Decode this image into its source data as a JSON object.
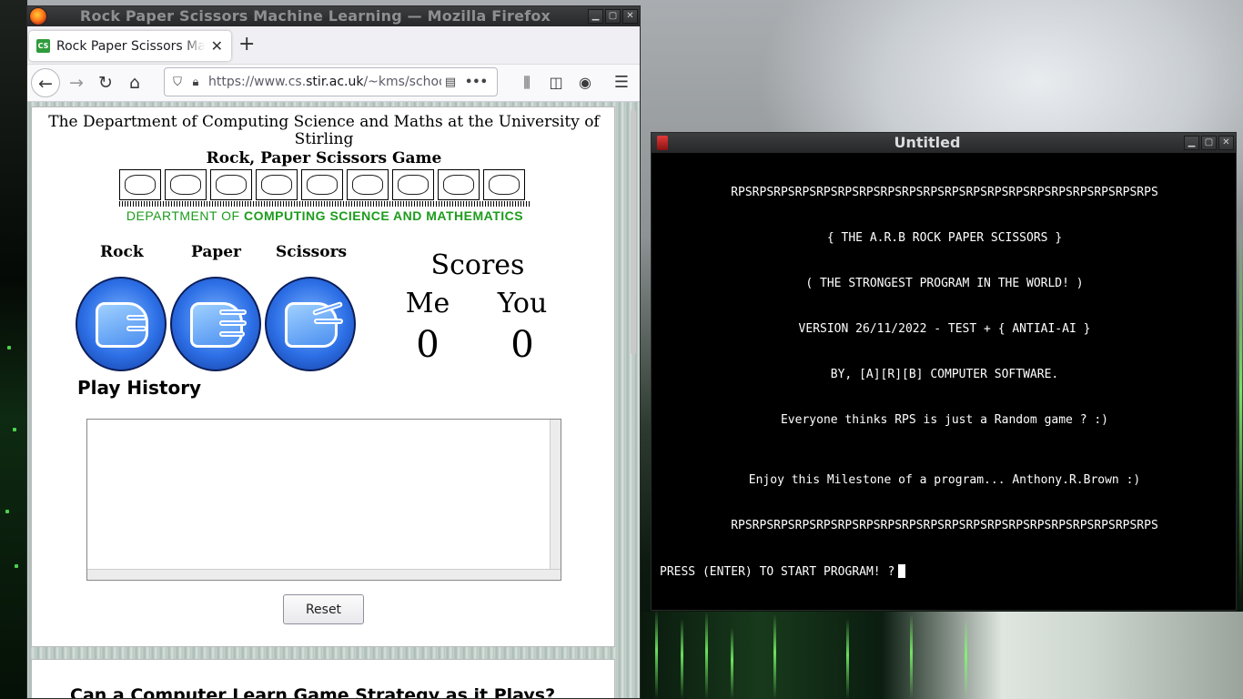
{
  "firefox": {
    "window_title": "Rock Paper Scissors Machine Learning — Mozilla Firefox",
    "tab_title": "Rock Paper Scissors Machine Learning",
    "url_prefix": "https://www.cs.",
    "url_domain": "stir.ac.uk",
    "url_suffix": "/~kms/schools/rps/",
    "icons": [
      "firefox-logo",
      "back-icon",
      "forward-icon",
      "reload-icon",
      "home-icon",
      "shield-icon",
      "lock-icon",
      "reader-icon",
      "more-icon",
      "library-icon",
      "sidebar-icon",
      "account-icon",
      "menu-icon"
    ]
  },
  "page": {
    "dept_line1": "The Department of Computing Science and Maths at the University of",
    "dept_line2": "Stirling",
    "game_title": "Rock, Paper Scissors Game",
    "banner_prefix": "DEPARTMENT OF ",
    "banner_main": "COMPUTING SCIENCE AND MATHEMATICS",
    "rock_label": "Rock",
    "paper_label": "Paper",
    "scissors_label": "Scissors",
    "scores_heading": "Scores",
    "me_label": "Me",
    "you_label": "You",
    "me_score": "0",
    "you_score": "0",
    "play_history_heading": "Play History",
    "history_text": "",
    "reset_label": "Reset",
    "next_section_heading": "Can a Computer Learn Game Strategy as it Plays?"
  },
  "terminal": {
    "window_title": "Untitled",
    "lines": [
      "RPSRPSRPSRPSRPSRPSRPSRPSRPSRPSRPSRPSRPSRPSRPSRPSRPSRPSRPSRPS",
      "{ THE A.R.B ROCK PAPER SCISSORS }",
      "( THE STRONGEST PROGRAM IN THE WORLD! )",
      "VERSION 26/11/2022 - TEST + { ANTIAI-AI }",
      "BY, [A][R][B] COMPUTER SOFTWARE.",
      "Everyone thinks RPS is just a Random game ? :)",
      "Enjoy this Milestone of a program... Anthony.R.Brown :)",
      "RPSRPSRPSRPSRPSRPSRPSRPSRPSRPSRPSRPSRPSRPSRPSRPSRPSRPSRPSRPS"
    ],
    "prompt": "PRESS (ENTER) TO START PROGRAM! ?"
  },
  "colors": {
    "banner_green": "#1c9c1c",
    "button_blue": "#2d6fe6",
    "terminal_bg": "#000000",
    "terminal_fg": "#ffffff"
  }
}
